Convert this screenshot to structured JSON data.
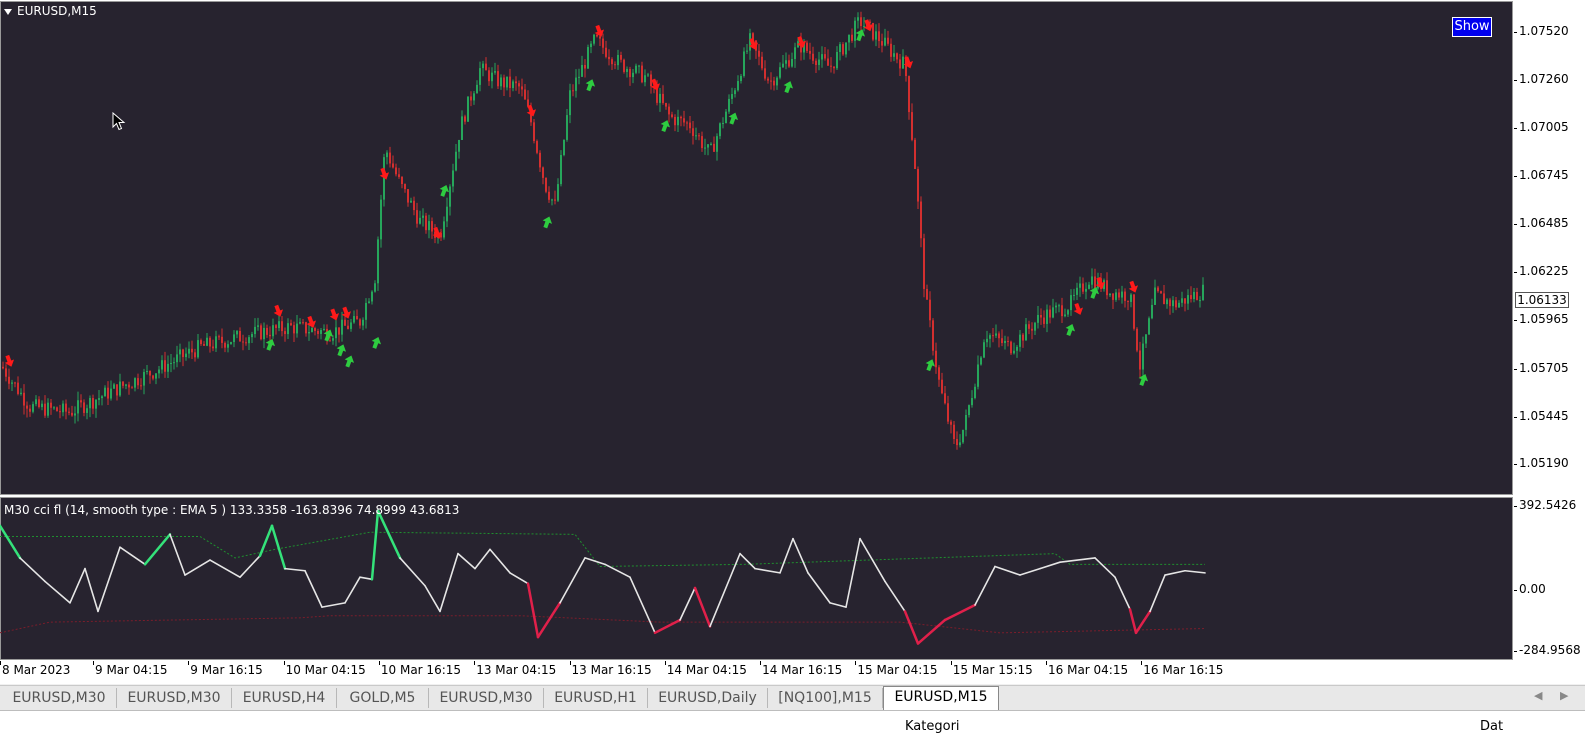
{
  "chart": {
    "title": "EURUSD,M15",
    "show_button": "Show",
    "current_price": "1.06133",
    "price_ticks": [
      "1.07520",
      "1.07260",
      "1.07005",
      "1.06745",
      "1.06485",
      "1.06225",
      "1.05965",
      "1.05705",
      "1.05445",
      "1.05190"
    ],
    "indicator_label": "M30 cci fl   (14, smooth type : EMA  5 ) 133.3358 -163.8396 74.8999 43.6813",
    "indicator_ticks": [
      "392.5426",
      "0.00",
      "-284.9568"
    ],
    "time_labels": [
      "8 Mar 2023",
      "9 Mar 04:15",
      "9 Mar 16:15",
      "10 Mar 04:15",
      "10 Mar 16:15",
      "13 Mar 04:15",
      "13 Mar 16:15",
      "14 Mar 04:15",
      "14 Mar 16:15",
      "15 Mar 04:15",
      "15 Mar 15:15",
      "16 Mar 04:15",
      "16 Mar 16:15"
    ],
    "colors": {
      "background": "#27232f",
      "bull": "#26a65b",
      "bear": "#d32f2f",
      "cci_line": "#e6e6e6",
      "cci_high": "#34e27a",
      "cci_low": "#e0204a",
      "signal_up": "#2ecc40",
      "signal_down": "#ff1a1a"
    }
  },
  "tabs": [
    {
      "label": "EURUSD,M30"
    },
    {
      "label": "EURUSD,M30"
    },
    {
      "label": "EURUSD,H4"
    },
    {
      "label": "GOLD,M5"
    },
    {
      "label": "EURUSD,M30"
    },
    {
      "label": "EURUSD,H1"
    },
    {
      "label": "EURUSD,Daily"
    },
    {
      "label": "[NQ100],M15"
    },
    {
      "label": "EURUSD,M15",
      "active": true
    }
  ],
  "tab_arrows": {
    "left": "◀",
    "right": "▶"
  },
  "bottom": {
    "left_text": "Kategori",
    "right_text": "Dat"
  },
  "chart_data": {
    "type": "line",
    "symbol": "EURUSD",
    "timeframe": "M15",
    "y_range": [
      1.0505,
      1.0765
    ],
    "price_path": [
      {
        "x": 0,
        "y": 1.0573
      },
      {
        "x": 30,
        "y": 1.055
      },
      {
        "x": 70,
        "y": 1.0547
      },
      {
        "x": 110,
        "y": 1.0558
      },
      {
        "x": 150,
        "y": 1.0568
      },
      {
        "x": 200,
        "y": 1.0582
      },
      {
        "x": 250,
        "y": 1.0589
      },
      {
        "x": 290,
        "y": 1.0593
      },
      {
        "x": 330,
        "y": 1.059
      },
      {
        "x": 360,
        "y": 1.0596
      },
      {
        "x": 375,
        "y": 1.062
      },
      {
        "x": 385,
        "y": 1.069
      },
      {
        "x": 400,
        "y": 1.067
      },
      {
        "x": 420,
        "y": 1.065
      },
      {
        "x": 440,
        "y": 1.0642
      },
      {
        "x": 460,
        "y": 1.07
      },
      {
        "x": 480,
        "y": 1.0732
      },
      {
        "x": 500,
        "y": 1.0725
      },
      {
        "x": 520,
        "y": 1.0722
      },
      {
        "x": 530,
        "y": 1.0706
      },
      {
        "x": 545,
        "y": 1.067
      },
      {
        "x": 555,
        "y": 1.0658
      },
      {
        "x": 570,
        "y": 1.0718
      },
      {
        "x": 595,
        "y": 1.0748
      },
      {
        "x": 620,
        "y": 1.0735
      },
      {
        "x": 645,
        "y": 1.0728
      },
      {
        "x": 670,
        "y": 1.0706
      },
      {
        "x": 690,
        "y": 1.0702
      },
      {
        "x": 710,
        "y": 1.0686
      },
      {
        "x": 730,
        "y": 1.0715
      },
      {
        "x": 750,
        "y": 1.0747
      },
      {
        "x": 770,
        "y": 1.0725
      },
      {
        "x": 800,
        "y": 1.0745
      },
      {
        "x": 830,
        "y": 1.0733
      },
      {
        "x": 860,
        "y": 1.0758
      },
      {
        "x": 880,
        "y": 1.0748
      },
      {
        "x": 905,
        "y": 1.0734
      },
      {
        "x": 915,
        "y": 1.068
      },
      {
        "x": 925,
        "y": 1.061
      },
      {
        "x": 940,
        "y": 1.056
      },
      {
        "x": 955,
        "y": 1.0528
      },
      {
        "x": 965,
        "y": 1.054
      },
      {
        "x": 985,
        "y": 1.059
      },
      {
        "x": 1010,
        "y": 1.0582
      },
      {
        "x": 1040,
        "y": 1.0598
      },
      {
        "x": 1070,
        "y": 1.0605
      },
      {
        "x": 1090,
        "y": 1.062
      },
      {
        "x": 1110,
        "y": 1.0612
      },
      {
        "x": 1130,
        "y": 1.061
      },
      {
        "x": 1140,
        "y": 1.0572
      },
      {
        "x": 1155,
        "y": 1.061
      },
      {
        "x": 1175,
        "y": 1.0605
      },
      {
        "x": 1205,
        "y": 1.0613
      }
    ],
    "signals_up": [
      {
        "x": 270,
        "y": 1.0583
      },
      {
        "x": 328,
        "y": 1.0588
      },
      {
        "x": 341,
        "y": 1.058
      },
      {
        "x": 349,
        "y": 1.0574
      },
      {
        "x": 376,
        "y": 1.0584
      },
      {
        "x": 444,
        "y": 1.0666
      },
      {
        "x": 547,
        "y": 1.0649
      },
      {
        "x": 590,
        "y": 1.0723
      },
      {
        "x": 665,
        "y": 1.0701
      },
      {
        "x": 733,
        "y": 1.0705
      },
      {
        "x": 788,
        "y": 1.0722
      },
      {
        "x": 860,
        "y": 1.075
      },
      {
        "x": 930,
        "y": 1.0572
      },
      {
        "x": 1070,
        "y": 1.0591
      },
      {
        "x": 1094,
        "y": 1.0611
      },
      {
        "x": 1143,
        "y": 1.0564
      }
    ],
    "signals_down": [
      {
        "x": 9,
        "y": 1.0575
      },
      {
        "x": 278,
        "y": 1.0602
      },
      {
        "x": 311,
        "y": 1.0596
      },
      {
        "x": 334,
        "y": 1.06
      },
      {
        "x": 346,
        "y": 1.0601
      },
      {
        "x": 384,
        "y": 1.0676
      },
      {
        "x": 437,
        "y": 1.0644
      },
      {
        "x": 531,
        "y": 1.071
      },
      {
        "x": 599,
        "y": 1.0753
      },
      {
        "x": 655,
        "y": 1.0724
      },
      {
        "x": 753,
        "y": 1.0746
      },
      {
        "x": 801,
        "y": 1.0747
      },
      {
        "x": 868,
        "y": 1.0756
      },
      {
        "x": 908,
        "y": 1.0736
      },
      {
        "x": 1078,
        "y": 1.0603
      },
      {
        "x": 1100,
        "y": 1.0617
      },
      {
        "x": 1133,
        "y": 1.0615
      }
    ],
    "cci": {
      "y_range": [
        -284.9568,
        392.5426
      ],
      "line": [
        {
          "x": 0,
          "y": 300
        },
        {
          "x": 20,
          "y": 150
        },
        {
          "x": 45,
          "y": 40
        },
        {
          "x": 70,
          "y": -60
        },
        {
          "x": 85,
          "y": 100
        },
        {
          "x": 98,
          "y": -100
        },
        {
          "x": 120,
          "y": 200
        },
        {
          "x": 145,
          "y": 120
        },
        {
          "x": 170,
          "y": 260
        },
        {
          "x": 185,
          "y": 70
        },
        {
          "x": 210,
          "y": 140
        },
        {
          "x": 240,
          "y": 60
        },
        {
          "x": 260,
          "y": 160
        },
        {
          "x": 272,
          "y": 300
        },
        {
          "x": 285,
          "y": 100
        },
        {
          "x": 305,
          "y": 90
        },
        {
          "x": 322,
          "y": -80
        },
        {
          "x": 345,
          "y": -60
        },
        {
          "x": 360,
          "y": 60
        },
        {
          "x": 372,
          "y": 50
        },
        {
          "x": 378,
          "y": 370
        },
        {
          "x": 400,
          "y": 150
        },
        {
          "x": 425,
          "y": 20
        },
        {
          "x": 440,
          "y": -100
        },
        {
          "x": 458,
          "y": 170
        },
        {
          "x": 475,
          "y": 100
        },
        {
          "x": 490,
          "y": 190
        },
        {
          "x": 510,
          "y": 80
        },
        {
          "x": 528,
          "y": 30
        },
        {
          "x": 538,
          "y": -220
        },
        {
          "x": 560,
          "y": -60
        },
        {
          "x": 585,
          "y": 150
        },
        {
          "x": 605,
          "y": 120
        },
        {
          "x": 630,
          "y": 60
        },
        {
          "x": 655,
          "y": -200
        },
        {
          "x": 680,
          "y": -140
        },
        {
          "x": 695,
          "y": 10
        },
        {
          "x": 710,
          "y": -170
        },
        {
          "x": 740,
          "y": 170
        },
        {
          "x": 755,
          "y": 100
        },
        {
          "x": 780,
          "y": 80
        },
        {
          "x": 793,
          "y": 240
        },
        {
          "x": 808,
          "y": 80
        },
        {
          "x": 830,
          "y": -60
        },
        {
          "x": 846,
          "y": -80
        },
        {
          "x": 860,
          "y": 240
        },
        {
          "x": 885,
          "y": 40
        },
        {
          "x": 905,
          "y": -100
        },
        {
          "x": 918,
          "y": -250
        },
        {
          "x": 945,
          "y": -140
        },
        {
          "x": 975,
          "y": -70
        },
        {
          "x": 995,
          "y": 110
        },
        {
          "x": 1020,
          "y": 70
        },
        {
          "x": 1040,
          "y": 100
        },
        {
          "x": 1060,
          "y": 130
        },
        {
          "x": 1095,
          "y": 150
        },
        {
          "x": 1115,
          "y": 60
        },
        {
          "x": 1130,
          "y": -90
        },
        {
          "x": 1136,
          "y": -200
        },
        {
          "x": 1150,
          "y": -100
        },
        {
          "x": 1165,
          "y": 70
        },
        {
          "x": 1185,
          "y": 90
        },
        {
          "x": 1205,
          "y": 80
        }
      ],
      "upper_band": [
        {
          "x": 0,
          "y": 250
        },
        {
          "x": 200,
          "y": 250
        },
        {
          "x": 235,
          "y": 150
        },
        {
          "x": 275,
          "y": 190
        },
        {
          "x": 370,
          "y": 270
        },
        {
          "x": 575,
          "y": 260
        },
        {
          "x": 600,
          "y": 110
        },
        {
          "x": 745,
          "y": 120
        },
        {
          "x": 1055,
          "y": 170
        },
        {
          "x": 1070,
          "y": 120
        },
        {
          "x": 1205,
          "y": 120
        }
      ],
      "lower_band": [
        {
          "x": 0,
          "y": -200
        },
        {
          "x": 50,
          "y": -150
        },
        {
          "x": 300,
          "y": -130
        },
        {
          "x": 330,
          "y": -120
        },
        {
          "x": 520,
          "y": -120
        },
        {
          "x": 660,
          "y": -150
        },
        {
          "x": 900,
          "y": -150
        },
        {
          "x": 1000,
          "y": -200
        },
        {
          "x": 1205,
          "y": -180
        }
      ]
    }
  }
}
